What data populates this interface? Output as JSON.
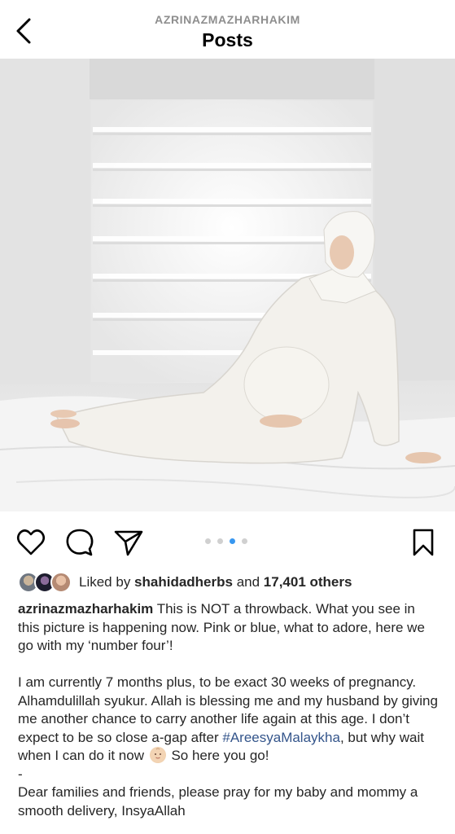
{
  "header": {
    "username": "AZRINAZMAZHARHAKIM",
    "title": "Posts",
    "back_icon": "chevron-left-icon"
  },
  "post": {
    "carousel": {
      "count": 4,
      "active_index": 2
    },
    "actions": {
      "like_icon": "heart-icon",
      "comment_icon": "comment-icon",
      "share_icon": "send-icon",
      "save_icon": "bookmark-icon"
    },
    "likes": {
      "prefix": "Liked by ",
      "user": "shahidadherbs",
      "middle": " and ",
      "count_text": "17,401 others"
    },
    "caption": {
      "username": "azrinazmazharhakim",
      "line1": " This is NOT a throwback. What you see in this picture is happening now. Pink or blue, what to adore, here we go with my ‘number four’!",
      "para2_a": "I am currently 7 months plus, to be exact 30 weeks of pregnancy. Alhamdulillah syukur. Allah is blessing me and my husband by giving me another chance to carry another life again at this age. I don’t expect to be so close a-gap after ",
      "hashtag": "#AreesyaMalaykha",
      "para2_b": ", but why wait when I can do it now ",
      "para2_c": " So here you go!",
      "dash": "-",
      "para3": "Dear families and friends, please pray for my baby and mommy a smooth delivery, InsyaAllah"
    }
  },
  "colors": {
    "accent": "#3897f0",
    "hashtag": "#34558b",
    "text": "#262626",
    "muted": "#8e8e8e"
  }
}
